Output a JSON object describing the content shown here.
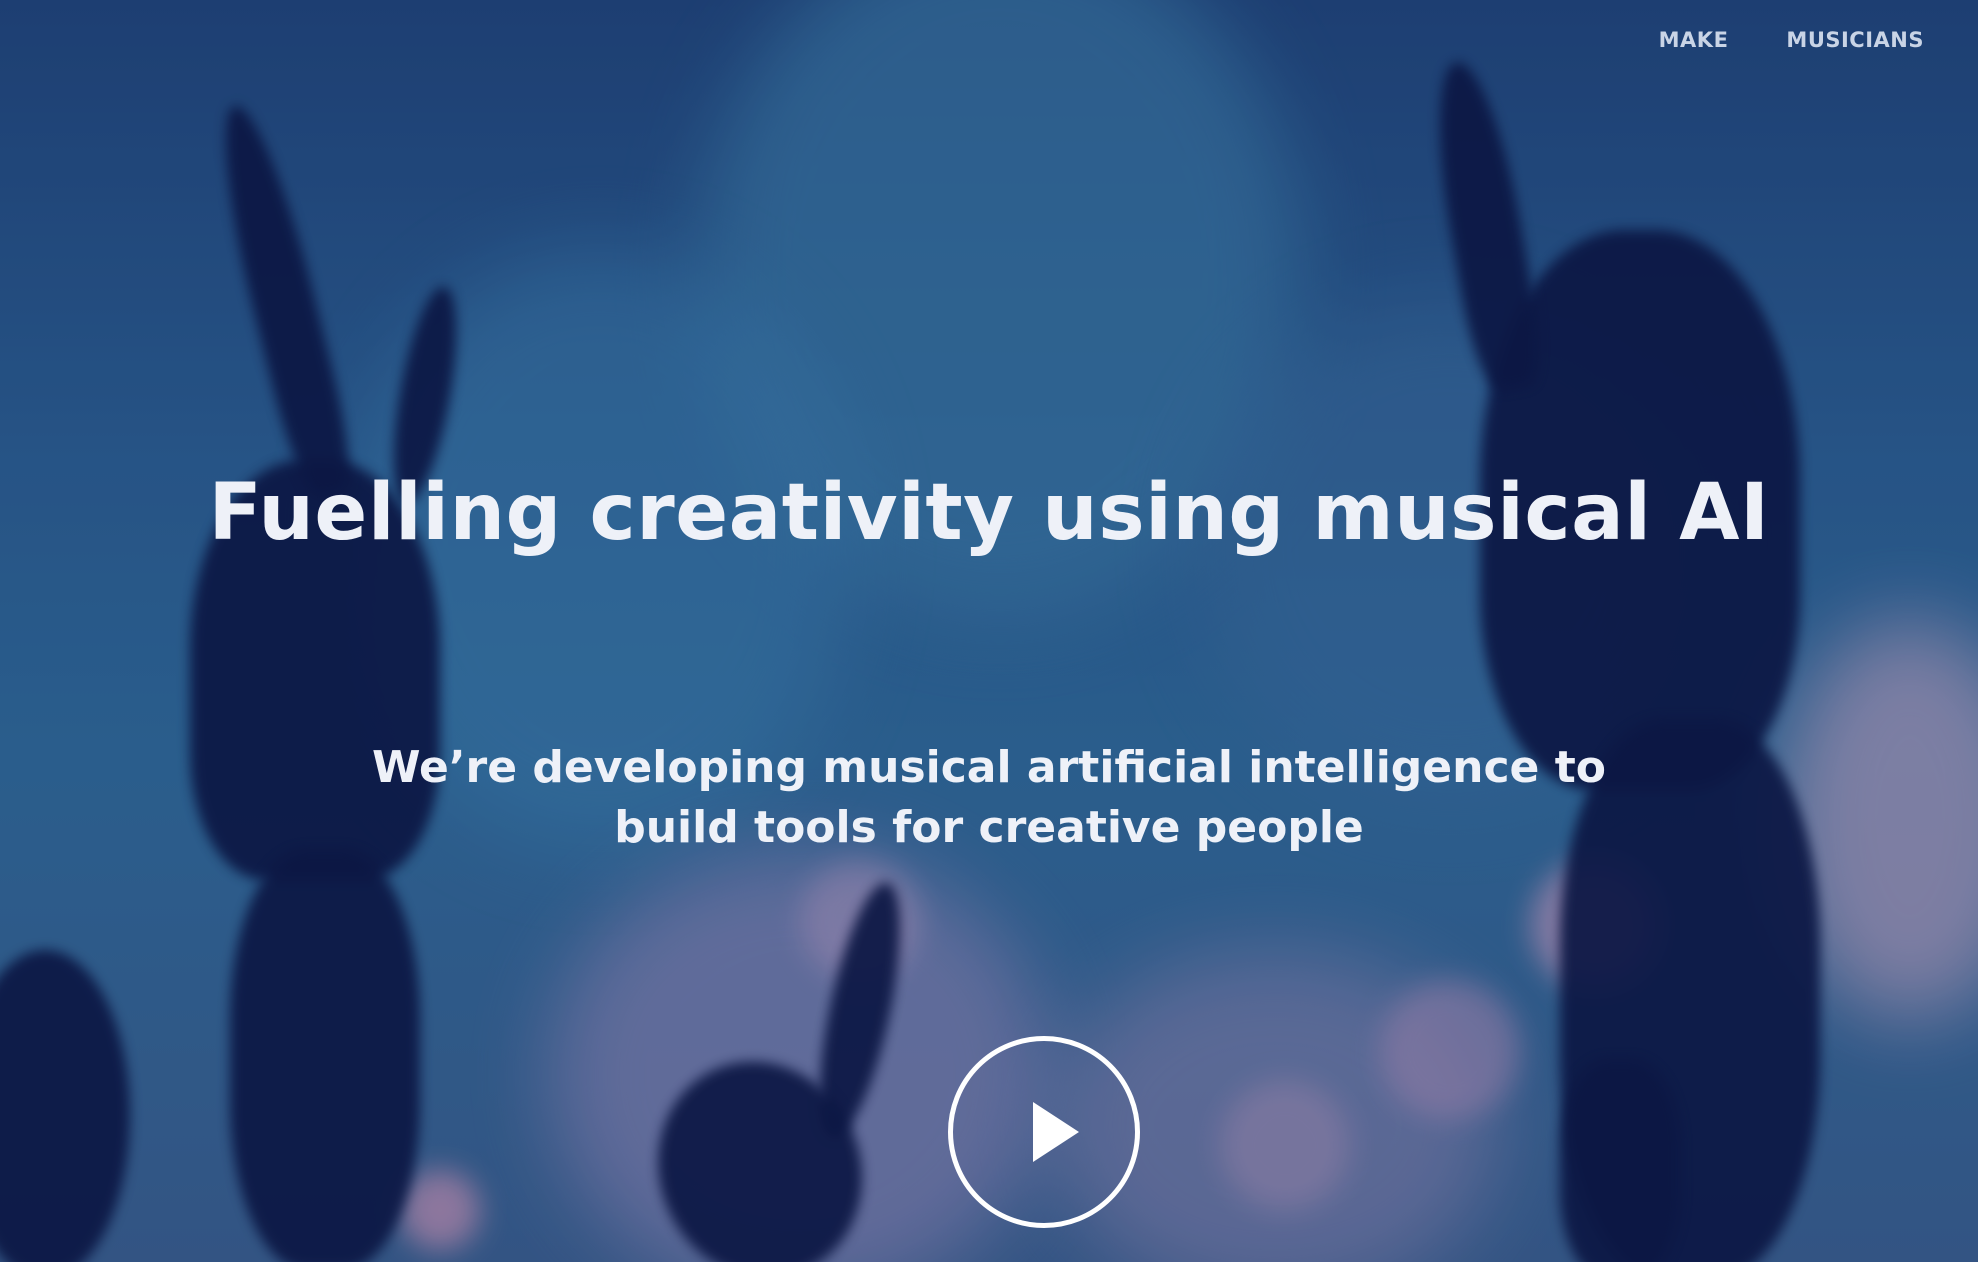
{
  "nav": {
    "items": [
      {
        "label": "MAKE"
      },
      {
        "label": "MUSICIANS"
      }
    ]
  },
  "hero": {
    "headline": "Fuelling creativity using musical AI",
    "subline_1": "We’re developing musical artificial intelligence to",
    "subline_2": "build tools for creative people"
  },
  "colors": {
    "text": "#eef1f8",
    "nav_text": "#c9d4e6",
    "background": "#2a5d8f",
    "silhouette": "#0a1440"
  },
  "icons": {
    "play": "play-icon"
  }
}
